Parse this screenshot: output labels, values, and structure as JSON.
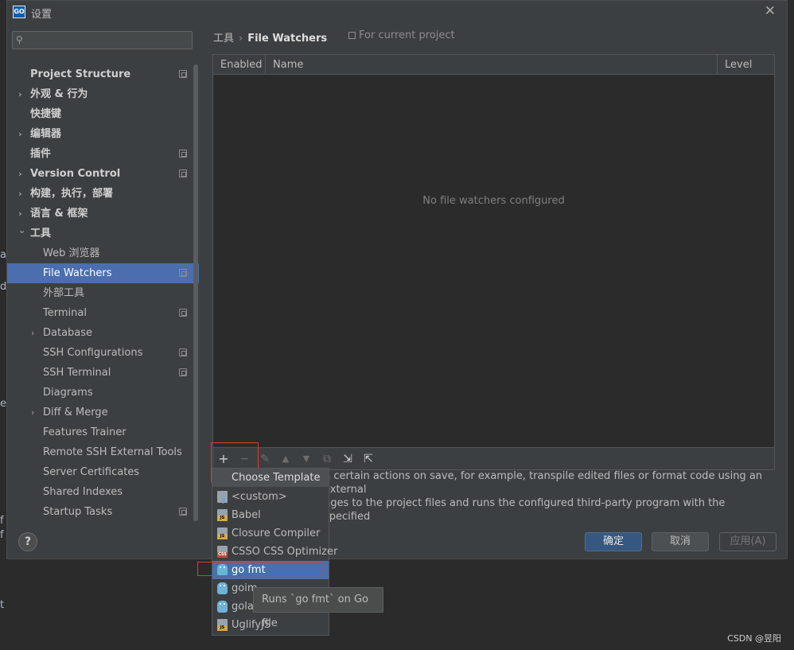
{
  "window": {
    "title": "设置",
    "app_icon": "GO"
  },
  "search": {
    "placeholder": ""
  },
  "sidebar": {
    "items": [
      {
        "label": "Project Structure",
        "bold": true,
        "arrow": "",
        "proj": true
      },
      {
        "label": "外观 & 行为",
        "bold": true,
        "arrow": "›",
        "proj": false
      },
      {
        "label": "快捷键",
        "bold": true,
        "arrow": "",
        "proj": false
      },
      {
        "label": "编辑器",
        "bold": true,
        "arrow": "›",
        "proj": false
      },
      {
        "label": "插件",
        "bold": true,
        "arrow": "",
        "proj": true
      },
      {
        "label": "Version Control",
        "bold": true,
        "arrow": "›",
        "proj": true
      },
      {
        "label": "构建，执行，部署",
        "bold": true,
        "arrow": "›",
        "proj": false
      },
      {
        "label": "语言 & 框架",
        "bold": true,
        "arrow": "›",
        "proj": false
      },
      {
        "label": "工具",
        "bold": true,
        "arrow": "⌄",
        "proj": false
      },
      {
        "label": "Web 浏览器",
        "bold": false,
        "arrow": "",
        "proj": false
      },
      {
        "label": "File Watchers",
        "bold": false,
        "arrow": "",
        "proj": true,
        "selected": true
      },
      {
        "label": "外部工具",
        "bold": false,
        "arrow": "",
        "proj": false
      },
      {
        "label": "Terminal",
        "bold": false,
        "arrow": "",
        "proj": true
      },
      {
        "label": "Database",
        "bold": false,
        "arrow": "›",
        "proj": false
      },
      {
        "label": "SSH Configurations",
        "bold": false,
        "arrow": "",
        "proj": true
      },
      {
        "label": "SSH Terminal",
        "bold": false,
        "arrow": "",
        "proj": true
      },
      {
        "label": "Diagrams",
        "bold": false,
        "arrow": "",
        "proj": false
      },
      {
        "label": "Diff & Merge",
        "bold": false,
        "arrow": "›",
        "proj": false
      },
      {
        "label": "Features Trainer",
        "bold": false,
        "arrow": "",
        "proj": false
      },
      {
        "label": "Remote SSH External Tools",
        "bold": false,
        "arrow": "",
        "proj": false
      },
      {
        "label": "Server Certificates",
        "bold": false,
        "arrow": "",
        "proj": false
      },
      {
        "label": "Shared Indexes",
        "bold": false,
        "arrow": "",
        "proj": false
      },
      {
        "label": "Startup Tasks",
        "bold": false,
        "arrow": "",
        "proj": true
      }
    ]
  },
  "breadcrumb": {
    "parent": "工具",
    "sep": "›",
    "current": "File Watchers"
  },
  "scope_label": "For current project",
  "table": {
    "columns": [
      "Enabled",
      "Name",
      "Level"
    ],
    "empty_text": "No file watchers configured"
  },
  "toolbar": {
    "add": "+",
    "remove": "−",
    "edit": "✎",
    "up": "▲",
    "down": "▼",
    "copy": "⧉",
    "import": "⇲",
    "export": "⇱"
  },
  "description": {
    "line1": "n certain actions on save, for example, transpile edited files or format code using an external",
    "line2": "nges to the project files and runs the configured third-party program with the specified"
  },
  "buttons": {
    "help": "?",
    "ok": "确定",
    "cancel": "取消",
    "apply": "应用(A)"
  },
  "popup": {
    "header": "Choose Template",
    "items": [
      {
        "label": "<custom>",
        "icon": "custom-icon"
      },
      {
        "label": "Babel",
        "icon": "js-file-icon"
      },
      {
        "label": "Closure Compiler",
        "icon": "js-file-icon"
      },
      {
        "label": "CSSO CSS Optimizer",
        "icon": "css-file-icon"
      },
      {
        "label": "go fmt",
        "icon": "gopher-icon",
        "selected": true
      },
      {
        "label": "goim",
        "icon": "gopher-icon"
      },
      {
        "label": "gola",
        "icon": "gopher-icon"
      },
      {
        "label": "UglifyJS",
        "icon": "js-file-icon"
      }
    ]
  },
  "tooltip": "Runs `go fmt` on Go file",
  "watermark": "CSDN @昱阳",
  "background_fragments": [
    "ar",
    "d",
    "es",
    "f",
    "f s",
    "t"
  ],
  "colors": {
    "selection": "#4b6eaf",
    "highlight_box": "#e0392f",
    "primary_button": "#365880"
  }
}
